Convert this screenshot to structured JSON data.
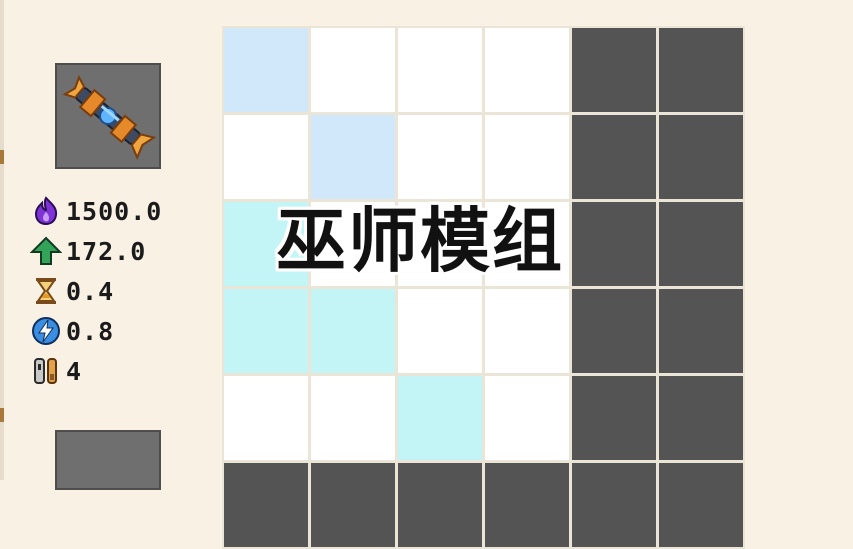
{
  "title": "巫师模组",
  "weapon": {
    "icon": "wizard-staff-icon"
  },
  "stats": [
    {
      "icon": "purple-flame-icon",
      "value": "1500.0"
    },
    {
      "icon": "green-up-arrow-icon",
      "value": "172.0"
    },
    {
      "icon": "hourglass-icon",
      "value": "0.4"
    },
    {
      "icon": "lightning-icon",
      "value": "0.8"
    },
    {
      "icon": "wrench-icon",
      "value": "4"
    }
  ],
  "grid": {
    "legend": {
      "w": "empty",
      "b": "light-blue",
      "c": "cyan",
      "d": "locked"
    },
    "colors": {
      "w": "#ffffff",
      "b": "#d1e8fb",
      "c": "#c4f5f6",
      "d": "#545454"
    },
    "rows": [
      [
        "b",
        "w",
        "w",
        "w",
        "d",
        "d"
      ],
      [
        "w",
        "b",
        "w",
        "w",
        "d",
        "d"
      ],
      [
        "c",
        "w",
        "w",
        "w",
        "d",
        "d"
      ],
      [
        "c",
        "c",
        "w",
        "w",
        "d",
        "d"
      ],
      [
        "w",
        "w",
        "c",
        "w",
        "d",
        "d"
      ],
      [
        "d",
        "d",
        "d",
        "d",
        "d",
        "d"
      ]
    ]
  }
}
